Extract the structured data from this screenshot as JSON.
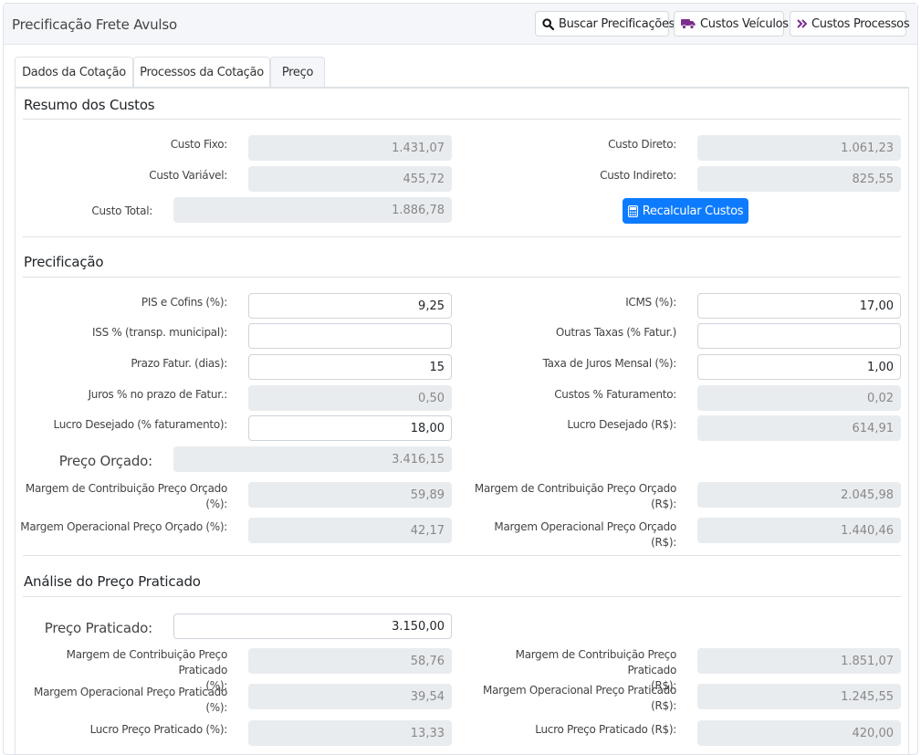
{
  "header": {
    "title": "Precificação Frete Avulso",
    "buttons": {
      "buscar": "Buscar Precificações",
      "veiculos": "Custos Veículos",
      "processos": "Custos Processos"
    }
  },
  "tabs": [
    "Dados da Cotação",
    "Processos da Cotação",
    "Preço"
  ],
  "resumo": {
    "title": "Resumo dos Custos",
    "custo_fixo_label": "Custo Fixo:",
    "custo_fixo": "1.431,07",
    "custo_direto_label": "Custo Direto:",
    "custo_direto": "1.061,23",
    "custo_variavel_label": "Custo Variável:",
    "custo_variavel": "455,72",
    "custo_indireto_label": "Custo Indireto:",
    "custo_indireto": "825,55",
    "custo_total_label": "Custo Total:",
    "custo_total": "1.886,78",
    "recalcular_label": "Recalcular Custos"
  },
  "precificacao": {
    "title": "Precificação",
    "pis_label": "PIS e Cofins (%):",
    "pis": "9,25",
    "icms_label": "ICMS (%):",
    "icms": "17,00",
    "iss_label": "ISS % (transp. municipal):",
    "iss": "",
    "outras_label": "Outras Taxas (% Fatur.)",
    "outras": "",
    "prazo_label": "Prazo Fatur. (dias):",
    "prazo": "15",
    "taxa_label": "Taxa de Juros Mensal (%):",
    "taxa": "1,00",
    "juros_label": "Juros % no prazo de Fatur.:",
    "juros": "0,50",
    "custos_fat_label": "Custos % Faturamento:",
    "custos_fat": "0,02",
    "lucro_pct_label": "Lucro Desejado (% faturamento):",
    "lucro_pct": "18,00",
    "lucro_rs_label": "Lucro Desejado (R$):",
    "lucro_rs": "614,91",
    "preco_orcado_label": "Preço Orçado:",
    "preco_orcado": "3.416,15",
    "mc_pct_label_1": "Margem de Contribuição Preço Orçado",
    "mc_pct_label_2": "(%):",
    "mc_pct": "59,89",
    "mc_rs_label_1": "Margem de Contribuição Preço Orçado",
    "mc_rs_label_2": "(R$):",
    "mc_rs": "2.045,98",
    "mo_pct_label": "Margem Operacional Preço Orçado (%):",
    "mo_pct": "42,17",
    "mo_rs_label": "Margem Operacional Preço Orçado (R$):",
    "mo_rs": "1.440,46"
  },
  "analise": {
    "title": "Análise do Preço Praticado",
    "preco_praticado_label": "Preço Praticado:",
    "preco_praticado": "3.150,00",
    "mc_pct_label_1": "Margem de Contribuição Preço Praticado",
    "mc_pct_label_2": "(%):",
    "mc_pct": "58,76",
    "mc_rs_label_1": "Margem de Contribuição Preço Praticado",
    "mc_rs_label_2": "(R$):",
    "mc_rs": "1.851,07",
    "mo_pct_label": "Margem Operacional Preço Praticado (%):",
    "mo_pct": "39,54",
    "mo_rs_label_1": "Margem Operacional Preço Praticado",
    "mo_rs_label_2": "(R$):",
    "mo_rs": "1.245,55",
    "lucro_pct_label": "Lucro Preço Praticado (%):",
    "lucro_pct": "13,33",
    "lucro_rs_label": "Lucro Preço Praticado (R$):",
    "lucro_rs": "420,00"
  },
  "colors": {
    "primary": "#0d7bff",
    "truck": "#7b2d8e",
    "readonly_bg": "#e9ecef"
  },
  "icons": [
    "search-icon",
    "truck-icon",
    "double-chevron-right-icon",
    "calculator-icon"
  ]
}
